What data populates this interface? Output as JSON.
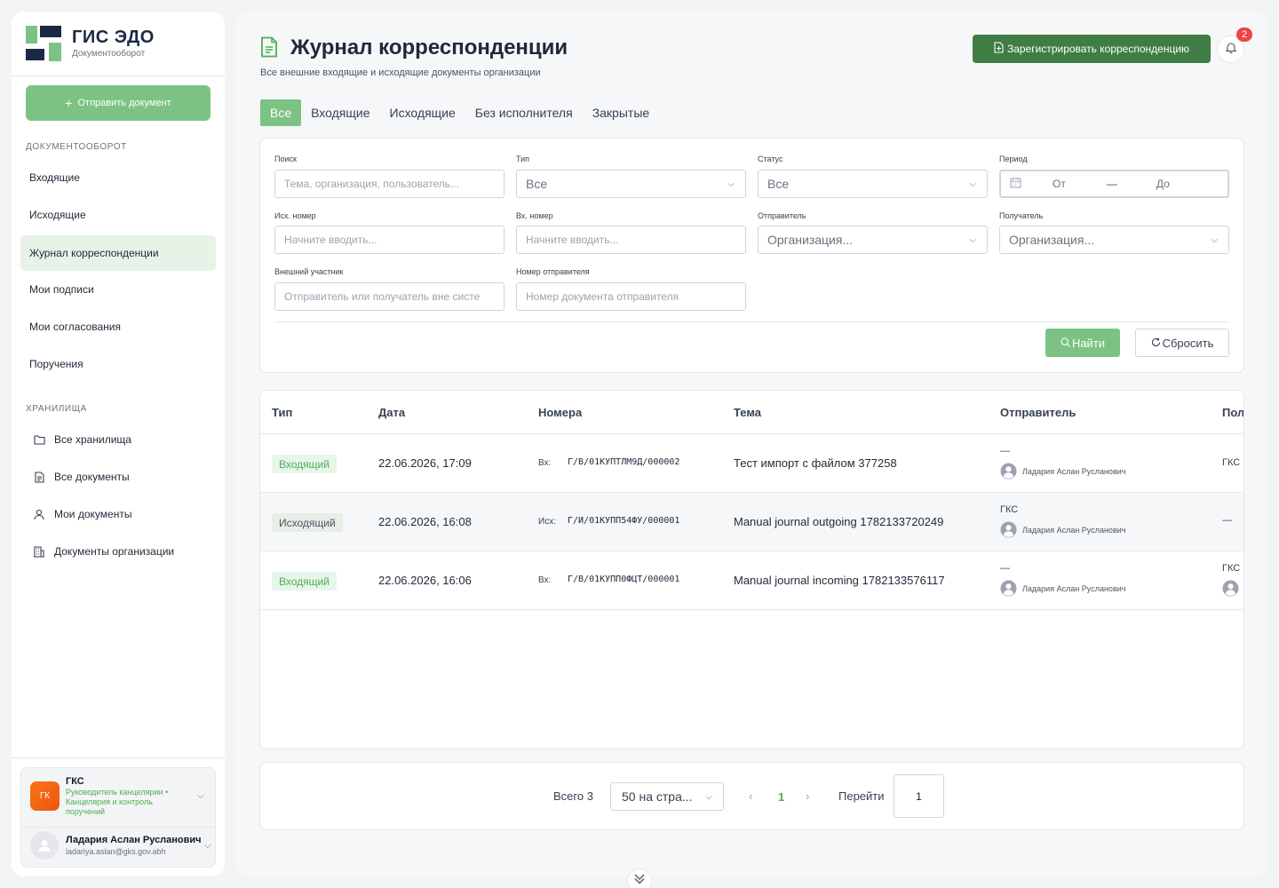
{
  "sidebar": {
    "logo_title": "ГИС ЭДО",
    "logo_subtitle": "Документооборот",
    "send_button": "Отправить документ",
    "section_docflow": "ДОКУМЕНТООБОРОТ",
    "docflow_items": [
      "Входящие",
      "Исходящие",
      "Журнал корреспонденции",
      "Мои подписи",
      "Мои согласования",
      "Поручения"
    ],
    "section_storage": "ХРАНИЛИЩА",
    "storage_items": [
      "Все хранилища",
      "Все документы",
      "Мои документы",
      "Документы организации"
    ],
    "org": {
      "avatar_text": "ГК",
      "name": "ГКС",
      "role": "Руководитель канцелярии • Канцелярия и контроль поручений"
    },
    "user": {
      "name": "Ладария Аслан Русланович",
      "email": "ladariya.aslan@gks.gov.abh"
    }
  },
  "header": {
    "title": "Журнал корреспонденции",
    "subtitle": "Все внешние входящие и исходящие документы организации",
    "register_button": "Зарегистрировать корреспонденцию",
    "notifications_count": "2"
  },
  "tabs": [
    "Все",
    "Входящие",
    "Исходящие",
    "Без исполнителя",
    "Закрытые"
  ],
  "filters": {
    "search": {
      "label": "Поиск",
      "placeholder": "Тема, организация, пользователь..."
    },
    "type": {
      "label": "Тип",
      "value": "Все"
    },
    "status": {
      "label": "Статус",
      "value": "Все"
    },
    "period": {
      "label": "Период",
      "from": "От",
      "to": "До"
    },
    "out_number": {
      "label": "Исх. номер",
      "placeholder": "Начните вводить..."
    },
    "in_number": {
      "label": "Вх. номер",
      "placeholder": "Начните вводить..."
    },
    "sender": {
      "label": "Отправитель",
      "placeholder": "Организация..."
    },
    "recipient": {
      "label": "Получатель",
      "placeholder": "Организация..."
    },
    "external": {
      "label": "Внешний участник",
      "placeholder": "Отправитель или получатель вне систе"
    },
    "sender_number": {
      "label": "Номер отправителя",
      "placeholder": "Номер документа отправителя"
    },
    "find_button": "Найти",
    "reset_button": "Сбросить"
  },
  "table": {
    "columns": [
      "Тип",
      "Дата",
      "Номера",
      "Тема",
      "Отправитель",
      "Пол"
    ],
    "rows": [
      {
        "type": "Входящий",
        "kind": "in",
        "date": "22.06.2026, 17:09",
        "num_label": "Вх:",
        "number": "Г/В/01КУПТЛМ9Д/000002",
        "topic": "Тест импорт с файлом 377258",
        "sender_org": "—",
        "sender_user": "Ладария Аслан Русланович",
        "recipient": "ГКС",
        "recipient_user": false
      },
      {
        "type": "Исходящий",
        "kind": "out",
        "date": "22.06.2026, 16:08",
        "num_label": "Исх:",
        "number": "Г/И/01КУПП54ФУ/000001",
        "topic": "Manual journal outgoing 1782133720249",
        "sender_org": "ГКС",
        "sender_user": "Ладария Аслан Русланович",
        "recipient": "—",
        "recipient_user": false
      },
      {
        "type": "Входящий",
        "kind": "in",
        "date": "22.06.2026, 16:06",
        "num_label": "Вх:",
        "number": "Г/В/01КУПП0ФЦТ/000001",
        "topic": "Manual journal incoming 1782133576117",
        "sender_org": "—",
        "sender_user": "Ладария Аслан Русланович",
        "recipient": "ГКС",
        "recipient_user": true
      }
    ]
  },
  "pagination": {
    "total": "Всего 3",
    "per_page": "50 на стра...",
    "current_page": "1",
    "goto_label": "Перейти",
    "goto_value": "1"
  },
  "colors": {
    "accent": "#7cc383",
    "primary_dark": "#3f7d45",
    "badge_in": "#4caf50",
    "notification": "#ef4444"
  }
}
